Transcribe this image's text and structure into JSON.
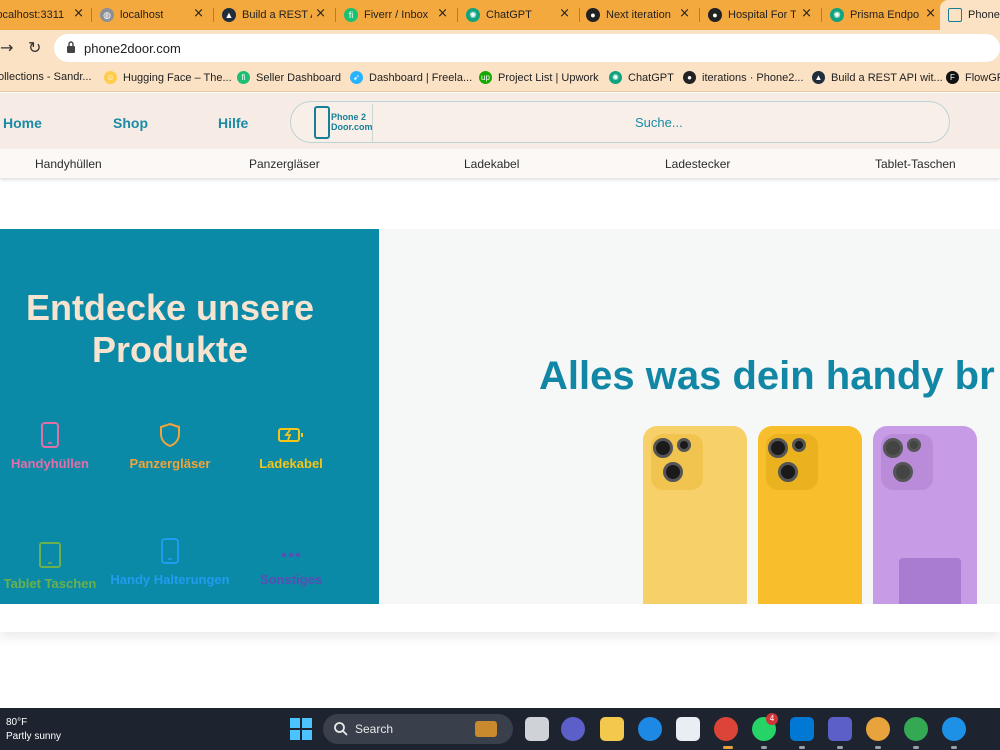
{
  "browser": {
    "tabs": [
      {
        "title": "localhost:3311",
        "icon": "globe-icon",
        "color": "#5f6368"
      },
      {
        "title": "localhost",
        "icon": "globe-icon",
        "color": "#5f6368"
      },
      {
        "title": "Build a REST API",
        "icon": "arrow-logo-icon",
        "color": "#1f2d3d"
      },
      {
        "title": "Fiverr / Inbox",
        "icon": "fiverr-icon",
        "color": "#1dbf73"
      },
      {
        "title": "ChatGPT",
        "icon": "chatgpt-icon",
        "color": "#10a37f"
      },
      {
        "title": "Next iteration",
        "icon": "github-icon",
        "color": "#222222"
      },
      {
        "title": "Hospital For T",
        "icon": "github-icon",
        "color": "#222222"
      },
      {
        "title": "Prisma Endpo",
        "icon": "chatgpt-icon",
        "color": "#10a37f"
      },
      {
        "title": "Phone",
        "icon": "phone-icon",
        "color": "#167f96"
      }
    ],
    "url": "phone2door.com",
    "bookmarks": [
      {
        "label": "ollections - Sandr...",
        "icon": "folder-icon",
        "color": "#f4a93f"
      },
      {
        "label": "Hugging Face – The...",
        "icon": "hugging-face-icon",
        "color": "#ffcc4d"
      },
      {
        "label": "Seller Dashboard",
        "icon": "fiverr-icon",
        "color": "#1dbf73"
      },
      {
        "label": "Dashboard | Freela...",
        "icon": "freelancer-icon",
        "color": "#29b2fe"
      },
      {
        "label": "Project List | Upwork",
        "icon": "upwork-icon",
        "color": "#14a800"
      },
      {
        "label": "ChatGPT",
        "icon": "chatgpt-icon",
        "color": "#10a37f"
      },
      {
        "label": "iterations · Phone2...",
        "icon": "github-icon",
        "color": "#222222"
      },
      {
        "label": "Build a REST API wit...",
        "icon": "arrow-logo-icon",
        "color": "#1f2d3d"
      },
      {
        "label": "FlowGP",
        "icon": "flow-icon",
        "color": "#111111"
      }
    ]
  },
  "site": {
    "nav": [
      "Home",
      "Shop",
      "Hilfe"
    ],
    "logo_text_1": "Phone 2",
    "logo_text_2": "Door.com",
    "search_placeholder": "Suche...",
    "categories": [
      "Handyhüllen",
      "Panzergläser",
      "Ladekabel",
      "Ladestecker",
      "Tablet-Taschen"
    ],
    "hero": {
      "heading_1": "Entdecke unsere",
      "heading_2": "Produkte",
      "items": [
        {
          "label": "Handyhüllen",
          "icon": "phone-icon",
          "color": "#e36fa8"
        },
        {
          "label": "Panzergläser",
          "icon": "shield-icon",
          "color": "#f2a33a"
        },
        {
          "label": "Ladekabel",
          "icon": "battery-charging-icon",
          "color": "#f5c518"
        },
        {
          "label": "Tablet Taschen",
          "icon": "tablet-icon",
          "color": "#6ab04c"
        },
        {
          "label": "Handy Halterungen",
          "icon": "phone-holder-icon",
          "color": "#1e9cf0"
        },
        {
          "label": "Sonstiges",
          "icon": "more-dots-icon",
          "color": "#5b4db3"
        }
      ],
      "slogan": "Alles was dein handy br",
      "case_colors": [
        "#f7d06a",
        "#f8be2b",
        "#c79be6"
      ]
    }
  },
  "taskbar": {
    "temperature": "80°F",
    "weather": "Partly sunny",
    "search_label": "Search",
    "whatsapp_badge": "4"
  }
}
